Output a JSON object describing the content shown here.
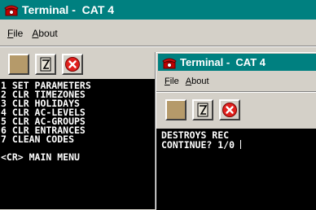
{
  "back_window": {
    "title": "Terminal -  CAT 4",
    "menu": [
      {
        "label": "File",
        "mnemonic": "F"
      },
      {
        "label": "About",
        "mnemonic": "A"
      }
    ],
    "terminal_lines": [
      "1 SET PARAMETERS",
      "2 CLR TIMEZONES",
      "3 CLR HOLIDAYS",
      "4 CLR AC-LEVELS",
      "5 CLR AC-GROUPS",
      "6 CLR ENTRANCES",
      "7 CLEAN CODES"
    ],
    "terminal_footer": "<CR> MAIN MENU"
  },
  "front_window": {
    "title": "Terminal -  CAT 4",
    "menu": [
      {
        "label": "File",
        "mnemonic": "F"
      },
      {
        "label": "About",
        "mnemonic": "A"
      }
    ],
    "terminal_lines": [
      "DESTROYS REC",
      "CONTINUE? 1/0 "
    ]
  },
  "colors": {
    "titlebar": "#008080",
    "window_bg": "#d4d0c8",
    "terminal_bg": "#000000",
    "terminal_fg": "#ffffff",
    "stop_button": "#e0201c",
    "square_button": "#b59a6a"
  },
  "icons": {
    "title_icon": "telephone-icon",
    "toolbar": [
      "square-icon",
      "phone-dial-icon",
      "stop-x-icon"
    ]
  }
}
